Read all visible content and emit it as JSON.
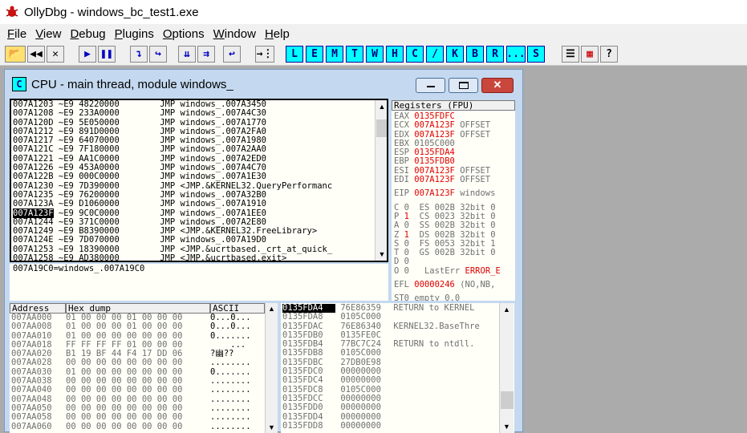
{
  "app": {
    "title": "OllyDbg - windows_bc_test1.exe"
  },
  "menu": [
    "File",
    "View",
    "Debug",
    "Plugins",
    "Options",
    "Window",
    "Help"
  ],
  "menu_underline": [
    "F",
    "V",
    "D",
    "P",
    "O",
    "W",
    "H"
  ],
  "toolbar": {
    "play_glyphs": [
      "▶",
      "❚❚"
    ],
    "letters": [
      "L",
      "E",
      "M",
      "T",
      "W",
      "H",
      "C",
      "/",
      "K",
      "B",
      "R",
      "...",
      "S"
    ],
    "help": "?"
  },
  "cpu_window": {
    "title": "CPU - main thread, module windows_",
    "icon_letter": "C"
  },
  "disasm": {
    "rows": [
      {
        "addr": "007A1203",
        "mark": "~",
        "hex": "E9 48220000",
        "cmd": "JMP windows_.007A3450"
      },
      {
        "addr": "007A1208",
        "mark": "~",
        "hex": "E9 233A0000",
        "cmd": "JMP windows_.007A4C30"
      },
      {
        "addr": "007A120D",
        "mark": "~",
        "hex": "E9 5E050000",
        "cmd": "JMP windows_.007A1770"
      },
      {
        "addr": "007A1212",
        "mark": "~",
        "hex": "E9 891D0000",
        "cmd": "JMP windows_.007A2FA0"
      },
      {
        "addr": "007A1217",
        "mark": "~",
        "hex": "E9 64070000",
        "cmd": "JMP windows_.007A1980"
      },
      {
        "addr": "007A121C",
        "mark": "~",
        "hex": "E9 7F180000",
        "cmd": "JMP windows_.007A2AA0"
      },
      {
        "addr": "007A1221",
        "mark": "~",
        "hex": "E9 AA1C0000",
        "cmd": "JMP windows_.007A2ED0"
      },
      {
        "addr": "007A1226",
        "mark": "~",
        "hex": "E9 453A0000",
        "cmd": "JMP windows_.007A4C70"
      },
      {
        "addr": "007A122B",
        "mark": "~",
        "hex": "E9 000C0000",
        "cmd": "JMP windows_.007A1E30"
      },
      {
        "addr": "007A1230",
        "mark": "~",
        "hex": "E9 7D390000",
        "cmd": "JMP <JMP.&KERNEL32.QueryPerformanc"
      },
      {
        "addr": "007A1235",
        "mark": "~",
        "hex": "E9 76200000",
        "cmd": "JMP windows_.007A32B0"
      },
      {
        "addr": "007A123A",
        "mark": "~",
        "hex": "E9 D1060000",
        "cmd": "JMP windows_.007A1910"
      },
      {
        "addr": "007A123F",
        "mark": "~",
        "hex": "E9 9C0C0000",
        "cmd": "JMP windows_.007A1EE0"
      },
      {
        "addr": "007A1244",
        "mark": "~",
        "hex": "E9 371C0000",
        "cmd": "JMP windows_.007A2E80"
      },
      {
        "addr": "007A1249",
        "mark": "~",
        "hex": "E9 B8390000",
        "cmd": "JMP <JMP.&KERNEL32.FreeLibrary>"
      },
      {
        "addr": "007A124E",
        "mark": "~",
        "hex": "E9 7D070000",
        "cmd": "JMP windows_.007A19D0"
      },
      {
        "addr": "007A1253",
        "mark": "~",
        "hex": "E9 18390000",
        "cmd": "JMP <JMP.&ucrtbased._crt_at_quick_"
      },
      {
        "addr": "007A1258",
        "mark": "~",
        "hex": "E9 AD380000",
        "cmd": "JMP <JMP.&ucrtbased.exit>"
      }
    ],
    "selected_index": 12,
    "info": "007A19C0=windows_.007A19C0"
  },
  "registers": {
    "header": "Registers (FPU)",
    "gp": [
      {
        "name": "EAX",
        "value": "0135FDFC",
        "comment": ""
      },
      {
        "name": "ECX",
        "value": "007A123F",
        "comment": "OFFSET"
      },
      {
        "name": "EDX",
        "value": "007A123F",
        "comment": "OFFSET"
      },
      {
        "name": "EBX",
        "value": "0105C000",
        "comment": ""
      },
      {
        "name": "ESP",
        "value": "0135FDA4",
        "comment": ""
      },
      {
        "name": "EBP",
        "value": "0135FDB0",
        "comment": ""
      },
      {
        "name": "ESI",
        "value": "007A123F",
        "comment": "OFFSET"
      },
      {
        "name": "EDI",
        "value": "007A123F",
        "comment": "OFFSET"
      }
    ],
    "gp_red": [
      true,
      true,
      true,
      false,
      true,
      true,
      true,
      true
    ],
    "eip": {
      "name": "EIP",
      "value": "007A123F",
      "comment": "windows"
    },
    "flags": [
      {
        "f": "C",
        "v": "0",
        "seg": "ES",
        "sv": "002B",
        "bits": "32bit",
        "b": "0"
      },
      {
        "f": "P",
        "v": "1",
        "seg": "CS",
        "sv": "0023",
        "bits": "32bit",
        "b": "0"
      },
      {
        "f": "A",
        "v": "0",
        "seg": "SS",
        "sv": "002B",
        "bits": "32bit",
        "b": "0"
      },
      {
        "f": "Z",
        "v": "1",
        "seg": "DS",
        "sv": "002B",
        "bits": "32bit",
        "b": "0"
      },
      {
        "f": "S",
        "v": "0",
        "seg": "FS",
        "sv": "0053",
        "bits": "32bit",
        "b": "1"
      },
      {
        "f": "T",
        "v": "0",
        "seg": "GS",
        "sv": "002B",
        "bits": "32bit",
        "b": "0"
      },
      {
        "f": "D",
        "v": "0",
        "seg": "",
        "sv": "",
        "bits": "",
        "b": ""
      }
    ],
    "lasterr": {
      "o": "O 0",
      "label": "LastErr",
      "value": "ERROR_E"
    },
    "efl": {
      "label": "EFL",
      "value": "00000246",
      "desc": "(NO,NB,"
    },
    "st0": "ST0 empty 0.0"
  },
  "dump": {
    "headers": [
      "Address",
      "Hex dump",
      "ASCII"
    ],
    "rows": [
      {
        "addr": "007AA000",
        "hex": "01 00 00 00 01 00 00 00",
        "ascii": "0...0..."
      },
      {
        "addr": "007AA008",
        "hex": "01 00 00 00 01 00 00 00",
        "ascii": "0...0..."
      },
      {
        "addr": "007AA010",
        "hex": "01 00 00 00 00 00 00 00",
        "ascii": "0......."
      },
      {
        "addr": "007AA018",
        "hex": "FF FF FF FF 01 00 00 00",
        "ascii": "    ..."
      },
      {
        "addr": "007AA020",
        "hex": "B1 19 BF 44 F4 17 DD 06",
        "ascii": "?幽??"
      },
      {
        "addr": "007AA028",
        "hex": "00 00 00 00 00 00 00 00",
        "ascii": "........"
      },
      {
        "addr": "007AA030",
        "hex": "01 00 00 00 00 00 00 00",
        "ascii": "0......."
      },
      {
        "addr": "007AA038",
        "hex": "00 00 00 00 00 00 00 00",
        "ascii": "........"
      },
      {
        "addr": "007AA040",
        "hex": "00 00 00 00 00 00 00 00",
        "ascii": "........"
      },
      {
        "addr": "007AA048",
        "hex": "00 00 00 00 00 00 00 00",
        "ascii": "........"
      },
      {
        "addr": "007AA050",
        "hex": "00 00 00 00 00 00 00 00",
        "ascii": "........"
      },
      {
        "addr": "007AA058",
        "hex": "00 00 00 00 00 00 00 00",
        "ascii": "........"
      },
      {
        "addr": "007AA060",
        "hex": "00 00 00 00 00 00 00 00",
        "ascii": "........"
      }
    ]
  },
  "stack": {
    "rows": [
      {
        "addr": "0135FDA4",
        "val": "76E86359",
        "cmt": "RETURN to KERNEL"
      },
      {
        "addr": "0135FDA8",
        "val": "0105C000",
        "cmt": ""
      },
      {
        "addr": "0135FDAC",
        "val": "76E86340",
        "cmt": "KERNEL32.BaseThre"
      },
      {
        "addr": "0135FDB0",
        "val": "0135FE0C",
        "cmt": ""
      },
      {
        "addr": "0135FDB4",
        "val": "77BC7C24",
        "cmt": "RETURN to ntdll."
      },
      {
        "addr": "0135FDB8",
        "val": "0105C000",
        "cmt": ""
      },
      {
        "addr": "0135FDBC",
        "val": "27DB0E98",
        "cmt": ""
      },
      {
        "addr": "0135FDC0",
        "val": "00000000",
        "cmt": ""
      },
      {
        "addr": "0135FDC4",
        "val": "00000000",
        "cmt": ""
      },
      {
        "addr": "0135FDC8",
        "val": "0105C000",
        "cmt": ""
      },
      {
        "addr": "0135FDCC",
        "val": "00000000",
        "cmt": ""
      },
      {
        "addr": "0135FDD0",
        "val": "00000000",
        "cmt": ""
      },
      {
        "addr": "0135FDD4",
        "val": "00000000",
        "cmt": ""
      },
      {
        "addr": "0135FDD8",
        "val": "00000000",
        "cmt": ""
      }
    ],
    "selected_index": 0
  }
}
